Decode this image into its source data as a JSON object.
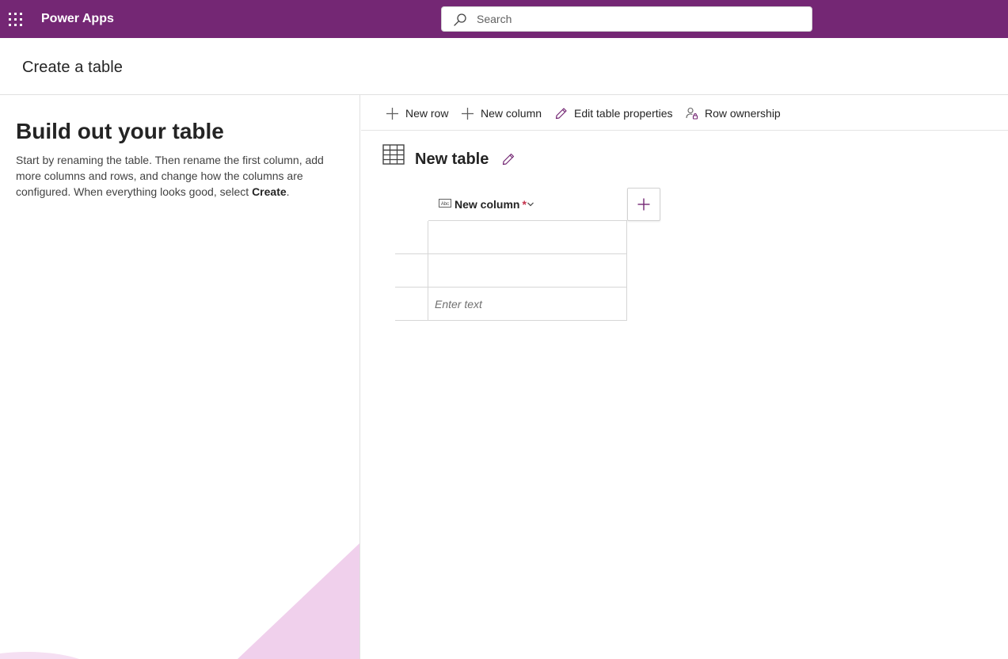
{
  "topbar": {
    "app_name": "Power Apps",
    "background_color": "#742774",
    "waffle_icon": "app-launcher-icon",
    "search": {
      "placeholder": "Search",
      "value": ""
    }
  },
  "page": {
    "title": "Create a table"
  },
  "left_pane": {
    "heading": "Build out your table",
    "description_text": "Start by renaming the table. Then rename the first column, add more columns and rows, and change how the columns are configured. When everything looks good, select ",
    "description_bold": "Create",
    "description_end": "."
  },
  "command_bar": {
    "new_row": "New row",
    "new_column": "New column",
    "edit_table_properties": "Edit table properties",
    "row_ownership": "Row ownership"
  },
  "table": {
    "name": "New table",
    "column": {
      "label": "New column",
      "required_marker": "*",
      "type_icon": "text-type-icon"
    },
    "rows": [
      {
        "value": "",
        "placeholder": ""
      },
      {
        "value": "",
        "placeholder": ""
      },
      {
        "value": "",
        "placeholder": "Enter text"
      }
    ]
  },
  "colors": {
    "accent": "#742774",
    "required": "#c4314b",
    "decoration": "#f0d0ec"
  }
}
